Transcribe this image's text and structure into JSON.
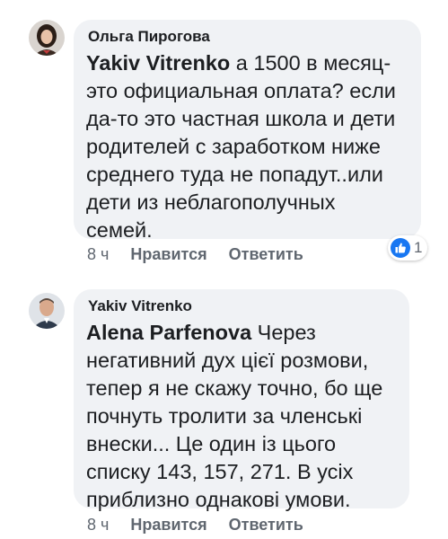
{
  "comments": [
    {
      "author": "Ольга Пирогова",
      "mention": "Yakiv Vitrenko",
      "text": "  а 1500 в месяц-\nэто официальная оплата? если\nда-то это частная школа и дети\nродителей с заработком ниже\nсреднего туда не попадут..или\nдети из неблагополучных\nсемей.",
      "time": "8 ч",
      "like_label": "Нравится",
      "reply_label": "Ответить",
      "reaction_icon": "like-icon",
      "reaction_count": "1",
      "colors": {
        "bubble": "#f0f2f5",
        "like": "#1877f2",
        "meta": "#606770"
      }
    },
    {
      "author": "Yakiv Vitrenko",
      "mention": "Alena Parfenova",
      "text": " Через\nнегативний дух цієї розмови,\nтепер я не скажу точно, бо ще\nпочнуть тролити за членські\nвнески... Це один із цього\nсписку 143, 157, 271. В усіх\nприблизно однакові умови.",
      "time": "8 ч",
      "like_label": "Нравится",
      "reply_label": "Ответить"
    }
  ]
}
